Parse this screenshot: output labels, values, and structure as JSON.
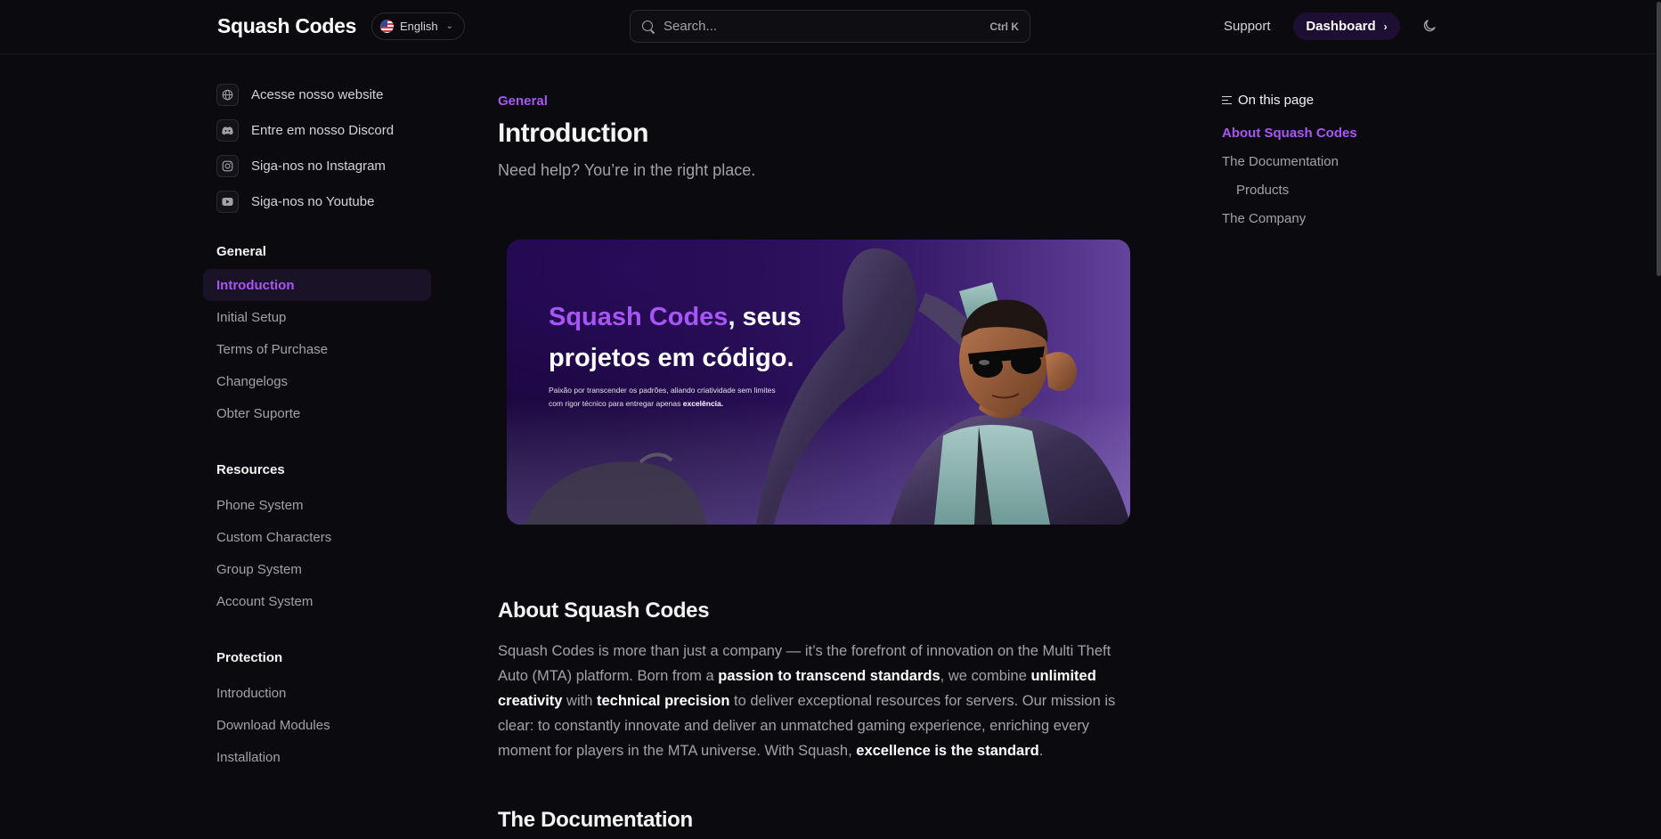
{
  "header": {
    "logo": "Squash Codes",
    "language": "English",
    "search": {
      "placeholder": "Search...",
      "shortcut": "Ctrl K"
    },
    "support_label": "Support",
    "dashboard_label": "Dashboard"
  },
  "sidebar": {
    "external_links": [
      {
        "label": "Acesse nosso website",
        "icon": "globe-icon"
      },
      {
        "label": "Entre em nosso Discord",
        "icon": "discord-icon"
      },
      {
        "label": "Siga-nos no Instagram",
        "icon": "instagram-icon"
      },
      {
        "label": "Siga-nos no Youtube",
        "icon": "youtube-icon"
      }
    ],
    "sections": [
      {
        "title": "General",
        "items": [
          "Introduction",
          "Initial Setup",
          "Terms of Purchase",
          "Changelogs",
          "Obter Suporte"
        ]
      },
      {
        "title": "Resources",
        "items": [
          "Phone System",
          "Custom Characters",
          "Group System",
          "Account System"
        ]
      },
      {
        "title": "Protection",
        "items": [
          "Introduction",
          "Download Modules",
          "Installation"
        ]
      }
    ],
    "active_item": "General / Introduction"
  },
  "main": {
    "eyebrow": "General",
    "title": "Introduction",
    "subtitle": "Need help? You’re in the right place.",
    "hero": {
      "brand": "Squash Codes",
      "headline_rest": ", seus projetos em código.",
      "tagline": "Paixão por transcender os padrões, aliando criatividade sem limites com rigor técnico para entregar apenas",
      "tagline_bold": "excelência."
    },
    "about": {
      "heading": "About Squash Codes",
      "p1": "Squash Codes is more than just a company — it’s the forefront of innovation on the Multi Theft Auto (MTA) platform. Born from a ",
      "b1": "passion to transcend standards",
      "p2": ", we combine ",
      "b2": "unlimited creativity",
      "p3": " with ",
      "b3": "technical precision",
      "p4": " to deliver exceptional resources for servers. Our mission is clear: to constantly innovate and deliver an unmatched gaming experience, enriching every moment for players in the MTA universe. With Squash, ",
      "b4": "excellence is the standard",
      "p5": "."
    },
    "documentation_heading": "The Documentation"
  },
  "toc": {
    "title": "On this page",
    "items": [
      "About Squash Codes",
      "The Documentation",
      "Products",
      "The Company"
    ]
  },
  "colors": {
    "accent": "#a855f7",
    "background": "#0b0b0f",
    "text_muted": "#a1a1aa"
  }
}
